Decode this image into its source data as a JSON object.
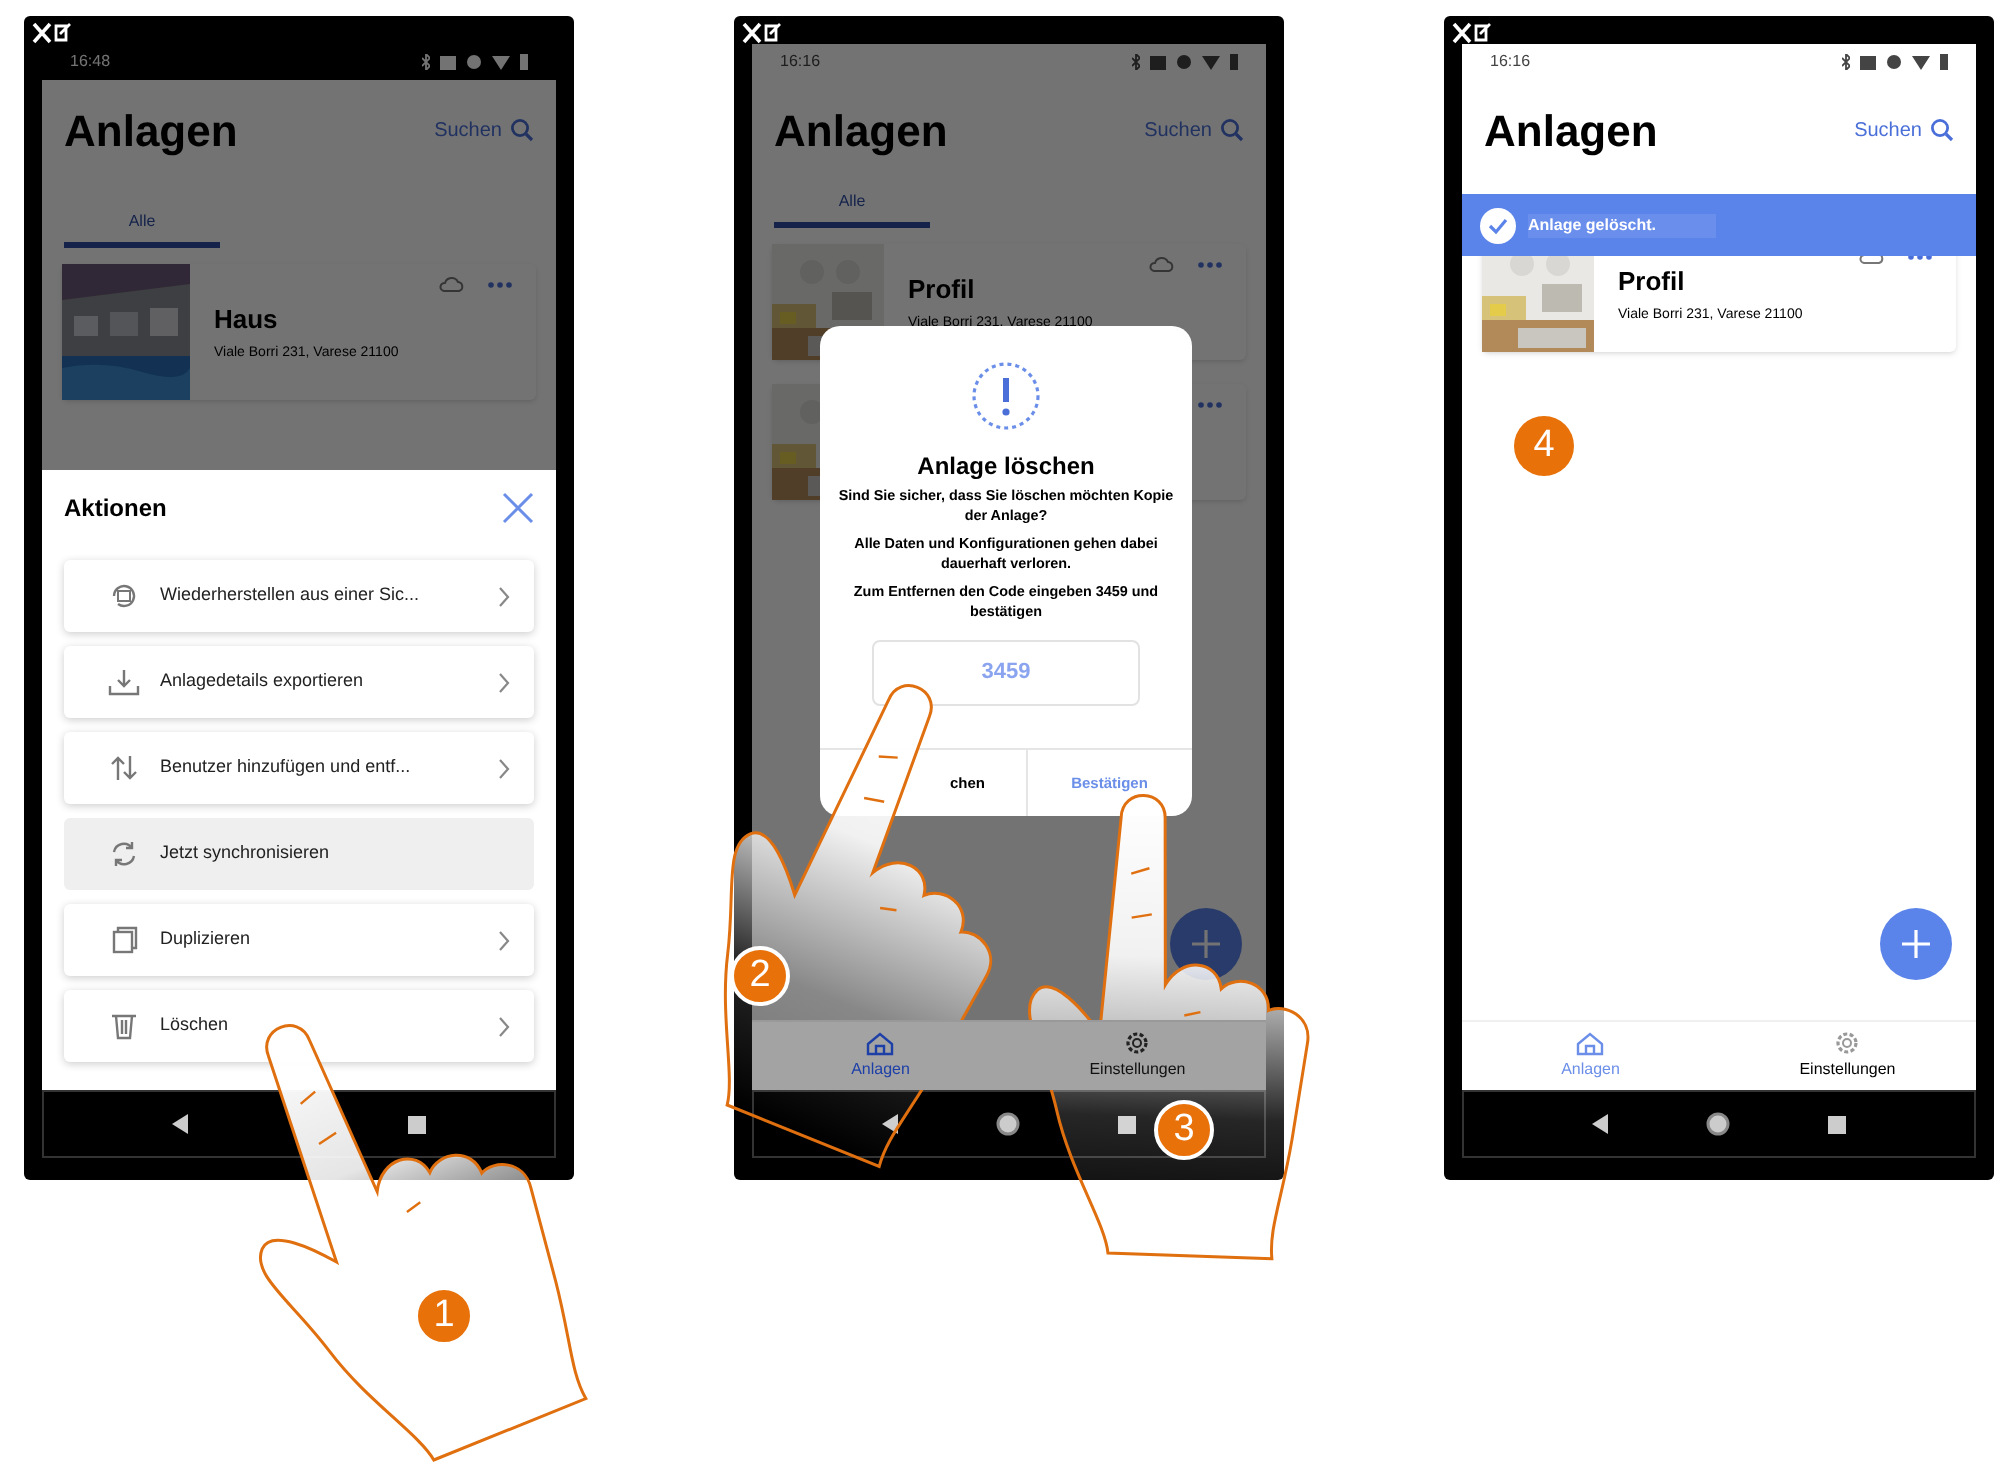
{
  "phones": [
    {
      "kind": "actions",
      "dimmed": true,
      "status_time": "16:48",
      "title": "Anlagen",
      "search": "Suchen",
      "tab": {
        "label": "Alle",
        "selected": true
      },
      "cards": [
        {
          "kind": "full",
          "name": "Haus",
          "address": "Viale Borri 231, Varese 21100"
        }
      ],
      "sheet": {
        "title": "Aktionen",
        "items": [
          {
            "label": "Wiederherstellen aus einer Sic...",
            "disabled": false
          },
          {
            "label": "Anlagedetails exportieren",
            "disabled": false
          },
          {
            "label": "Benutzer hinzufügen und entf...",
            "disabled": false
          },
          {
            "label": "Jetzt synchronisieren",
            "disabled": true
          },
          {
            "label": "Duplizieren",
            "disabled": false
          },
          {
            "label": "Löschen",
            "disabled": false
          }
        ]
      },
      "steps": [
        "1"
      ]
    },
    {
      "kind": "confirm",
      "dimmed": true,
      "status_time": "16:16",
      "title": "Anlagen",
      "search": "Suchen",
      "tab": {
        "label": "Alle",
        "selected": true
      },
      "cards": [
        {
          "kind": "full",
          "name": "Profil",
          "address": "Viale Borri 231, Varese 21100"
        },
        {
          "kind": "covered"
        }
      ],
      "dialog": {
        "title": "Anlage löschen",
        "lines": [
          "Sind Sie sicher, dass Sie löschen möchten Kopie der Anlage?",
          "Alle Daten und Konfigurationen gehen dabei dauerhaft verloren.",
          "Zum Entfernen den Code eingeben  3459 und bestätigen"
        ],
        "code": "3459",
        "buttons": [
          "chen",
          "Bestätigen"
        ]
      },
      "fab": true,
      "bottom_tabs": [
        {
          "label": "Anlagen",
          "selected": true
        },
        {
          "label": "Einstellungen",
          "selected": false
        }
      ],
      "steps": [
        "2",
        "3"
      ]
    },
    {
      "kind": "done",
      "dimmed": false,
      "status_time": "16:16",
      "title": "Anlagen",
      "search": "Suchen",
      "toast": "Anlage gelöscht.",
      "cards": [
        {
          "kind": "full",
          "name": "Profil",
          "address": "Viale Borri 231, Varese 21100"
        }
      ],
      "fab": true,
      "bottom_tabs": [
        {
          "label": "Anlagen",
          "selected": true
        },
        {
          "label": "Einstellungen",
          "selected": false
        }
      ],
      "steps": [
        "4"
      ]
    }
  ]
}
